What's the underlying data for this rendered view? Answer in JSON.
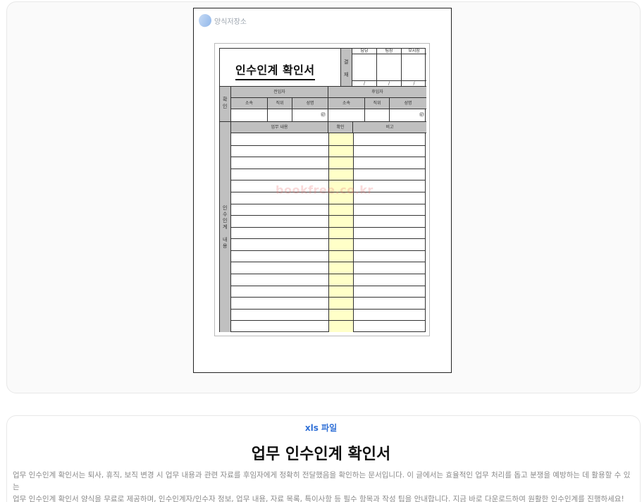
{
  "logo": {
    "text": "양식저장소"
  },
  "form": {
    "title": "인수인계 확인서",
    "approval": {
      "label_chars": [
        "결",
        "재"
      ],
      "columns": [
        "담당",
        "팀장",
        "부서장"
      ],
      "date_mark": "/"
    },
    "confirm": {
      "label_chars": [
        "확",
        "인"
      ],
      "giver_header": "전임자",
      "receiver_header": "후임자",
      "giver_cols": [
        "소속",
        "직위",
        "성명"
      ],
      "receiver_cols": [
        "소속",
        "직위",
        "성명"
      ],
      "seal": "㊞"
    },
    "content": {
      "label_chars": [
        "인",
        "수",
        "인",
        "계",
        " ",
        "내",
        "용"
      ],
      "headers": [
        "업무 내용",
        "확인",
        "비고"
      ],
      "row_count": 17
    },
    "watermark": "bookfree.co.kr"
  },
  "article": {
    "file_type": "xls 파일",
    "title": "업무 인수인계 확인서",
    "description_lines": [
      "업무 인수인계 확인서는 퇴사, 휴직, 보직 변경 시 업무 내용과 관련 자료를 후임자에게 정확히 전달했음을 확인하는 문서입니다. 이 글에서는 효율적인 업무 처리를 돕고 분쟁을 예방하는 데 활용할 수 있는",
      "업무 인수인계 확인서 양식을 무료로 제공하며, 인수인계자/인수자 정보, 업무 내용, 자료 목록, 특이사항 등 필수 항목과 작성 팁을 안내합니다. 지금 바로 다운로드하여 원활한 인수인계를 진행하세요!"
    ]
  },
  "colors": {
    "accent": "#2f6fd6",
    "header_gray": "#c0c0c0",
    "check_yellow": "#ffffc8",
    "watermark": "#e87878"
  }
}
